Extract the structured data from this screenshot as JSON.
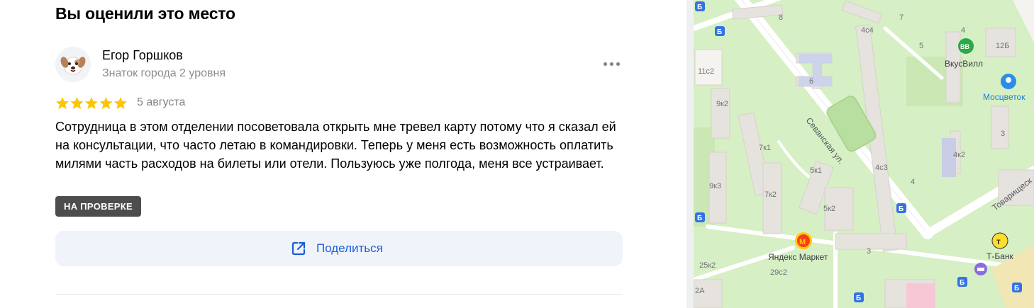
{
  "review": {
    "section_title": "Вы оценили это место",
    "author": {
      "name": "Егор Горшков",
      "level": "Знаток города 2 уровня",
      "avatar_icon": "dog-avatar-icon"
    },
    "rating": 5,
    "rating_max": 5,
    "date": "5 августа",
    "text": "Сотрудница в этом отделении посоветовала открыть мне тревел карту потому что я сказал ей на консультации, что часто летаю в командировки. Теперь у меня есть возможность оплатить милями часть расходов на билеты или отели. Пользуюсь уже полгода, меня все устраивает.",
    "status_badge": "НА ПРОВЕРКЕ",
    "share_label": "Поделиться",
    "more_icon": "more-dots-icon",
    "share_icon": "share-external-icon"
  },
  "colors": {
    "star": "#fcc602",
    "link": "#1b5cd9",
    "badge_bg": "#4d4d4d",
    "share_bg": "#f0f3f9",
    "map_green": "#d6efc4",
    "building": "#e6e3de",
    "road": "#ffffff",
    "transit_blue": "#3373e8",
    "vkusvill_green": "#2aa84a",
    "mostsvetok_blue": "#2a8ee8",
    "tbank_yellow": "#ffdd2d"
  },
  "map": {
    "street_labels": [
      "Севанская ул.",
      "Товарищеск"
    ],
    "building_labels": [
      "6",
      "7",
      "8",
      "4с4",
      "5",
      "4",
      "12Б",
      "11с2",
      "9к2",
      "7к1",
      "5к1",
      "4с3",
      "4к2",
      "3",
      "9к3",
      "7к2",
      "5к2",
      "4",
      "3",
      "25к2",
      "29с2",
      "2А"
    ],
    "places": [
      {
        "name": "ВкусВилл",
        "icon": "vkusvill-icon"
      },
      {
        "name": "Мосцветок",
        "icon": "flower-shop-icon"
      },
      {
        "name": "Яндекс Маркет",
        "icon": "yandex-market-icon"
      },
      {
        "name": "Т-Банк",
        "icon": "tbank-icon"
      }
    ]
  }
}
